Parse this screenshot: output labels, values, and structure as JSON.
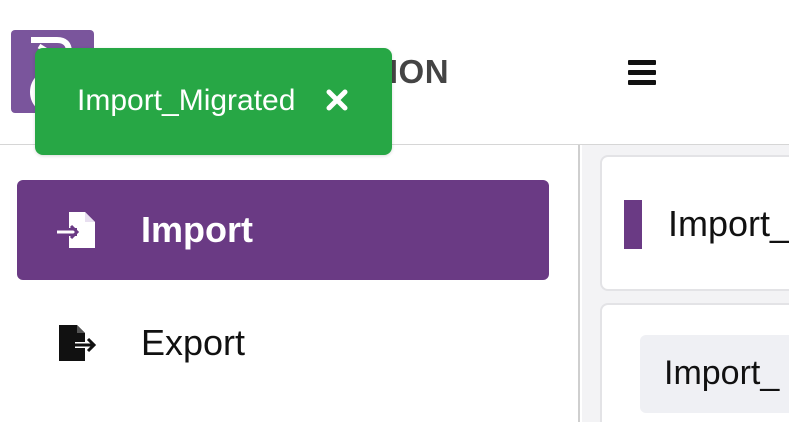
{
  "header": {
    "app_title": "RATION",
    "menu_icon": "hamburger-menu-icon",
    "logo_icon": "app-logo-icon"
  },
  "toast": {
    "message": "Import_Migrated",
    "close_icon": "close-icon",
    "color": "#27a745"
  },
  "sidebar": {
    "items": [
      {
        "label": "Import",
        "icon": "file-import-icon",
        "active": true
      },
      {
        "label": "Export",
        "icon": "file-export-icon",
        "active": false
      }
    ]
  },
  "content": {
    "title": "Import_",
    "body_label": "Import_"
  },
  "colors": {
    "accent": "#6a3a84",
    "logo_bg": "#7a559c",
    "success": "#27a745"
  }
}
